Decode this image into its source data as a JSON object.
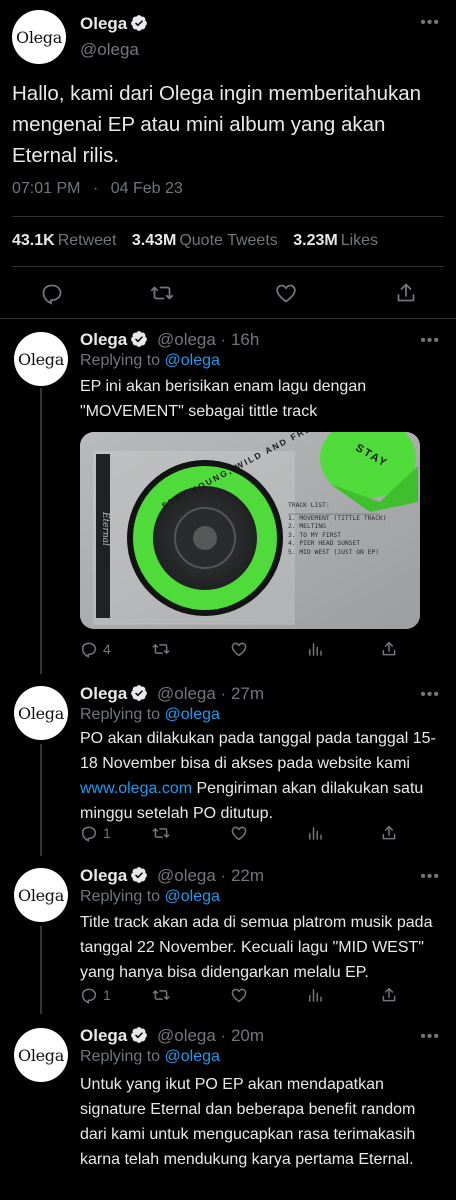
{
  "colors": {
    "background": "#000000",
    "text": "#e7e9ea",
    "muted": "#71767b",
    "link": "#1d9bf0",
    "verified": "#1d9bf0",
    "accent_green": "#4fdc3b"
  },
  "main": {
    "avatar_text": "Olega",
    "name": "Olega",
    "handle": "@olega",
    "more_icon": "more-dots-icon",
    "text": "Hallo, kami dari Olega ingin memberitahukan mengenai EP atau mini album yang akan Eternal rilis.",
    "time": "07:01 PM",
    "separator": "·",
    "date": "04 Feb 23",
    "stats": [
      {
        "value": "43.1K",
        "label": "Retweet"
      },
      {
        "value": "3.43M",
        "label": "Quote Tweets"
      },
      {
        "value": "3.23M",
        "label": "Likes"
      }
    ]
  },
  "replies": [
    {
      "avatar_text": "Olega",
      "name": "Olega",
      "handle_time": "@olega · 16h",
      "replying_prefix": "Replying to",
      "replying_handle": "@olega",
      "text_lines": [
        "EP ini akan berisikan enam lagu dengan",
        "\"MOVEMENT\" sebagai tittle track"
      ],
      "media": {
        "track_list_title": "TRACK LIST:",
        "tracks": [
          "1. MOVEMENT (TITTLE TRACK)",
          "2. MELTING",
          "3. TO MY FIRST",
          "4. PIER HEAD SUNSET",
          "5. MID WEST (JUST ON EP)"
        ],
        "ring_text": "STAY YOUNG, WILD AND FREE",
        "sticker_text": "STAY",
        "signature": "Eternal"
      },
      "reply_count": "4"
    },
    {
      "avatar_text": "Olega",
      "name": "Olega",
      "handle_time": "@olega · 27m",
      "replying_prefix": "Replying to",
      "replying_handle": "@olega",
      "text_a": "PO akan dilakukan pada tanggal pada tanggal 15-18 November bisa di akses pada website kami ",
      "link": "www.olega.com",
      "text_b": " Pengiriman akan dilakukan satu minggu setelah PO ditutup.",
      "reply_count": "1"
    },
    {
      "avatar_text": "Olega",
      "name": "Olega",
      "handle_time": "@olega · 22m",
      "replying_prefix": "Replying to",
      "replying_handle": "@olega",
      "text": "Title track akan ada di semua platrom musik pada tanggal 22 November. Kecuali lagu \"MID WEST\" yang hanya bisa didengarkan melalu EP.",
      "reply_count": "1"
    },
    {
      "avatar_text": "Olega",
      "name": "Olega",
      "handle_time": "@olega · 20m",
      "replying_prefix": "Replying to",
      "replying_handle": "@olega",
      "text": "Untuk yang ikut PO EP akan mendapatkan signature Eternal dan beberapa benefit random dari kami untuk mengucapkan rasa terimakasih karna telah mendukung karya pertama Eternal."
    }
  ]
}
